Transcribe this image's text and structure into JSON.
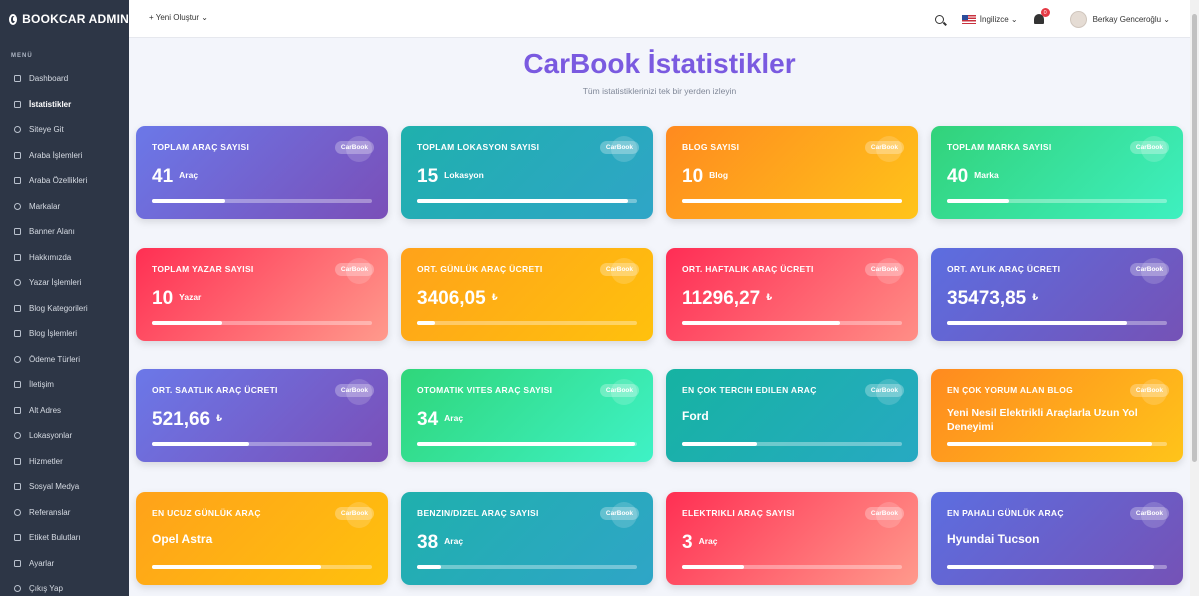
{
  "brand": {
    "title": "BOOKCAR ADMIN"
  },
  "sidebar": {
    "section_title": "MENÜ",
    "items": [
      {
        "label": "Dashboard",
        "icon": "dashboard-icon"
      },
      {
        "label": "İstatistikler",
        "icon": "chart-icon",
        "active": true
      },
      {
        "label": "Siteye Git",
        "icon": "globe-icon"
      },
      {
        "label": "Araba İşlemleri",
        "icon": "car-icon"
      },
      {
        "label": "Araba Özellikleri",
        "icon": "list-icon"
      },
      {
        "label": "Markalar",
        "icon": "briefcase-icon"
      },
      {
        "label": "Banner Alanı",
        "icon": "image-icon"
      },
      {
        "label": "Hakkımızda",
        "icon": "info-icon"
      },
      {
        "label": "Yazar İşlemleri",
        "icon": "pen-icon"
      },
      {
        "label": "Blog Kategorileri",
        "icon": "tag-icon"
      },
      {
        "label": "Blog İşlemleri",
        "icon": "document-icon"
      },
      {
        "label": "Ödeme Türleri",
        "icon": "money-icon"
      },
      {
        "label": "İletişim",
        "icon": "mail-icon"
      },
      {
        "label": "Alt Adres",
        "icon": "address-icon"
      },
      {
        "label": "Lokasyonlar",
        "icon": "location-icon"
      },
      {
        "label": "Hizmetler",
        "icon": "shield-icon"
      },
      {
        "label": "Sosyal Medya",
        "icon": "share-icon"
      },
      {
        "label": "Referanslar",
        "icon": "users-icon"
      },
      {
        "label": "Etiket Bulutları",
        "icon": "cloud-icon"
      },
      {
        "label": "Ayarlar",
        "icon": "gear-icon"
      },
      {
        "label": "Çıkış Yap",
        "icon": "logout-icon"
      }
    ]
  },
  "topbar": {
    "new_label": "+ Yeni Oluştur ⌄",
    "language": "İngilizce ⌄",
    "notification_count": "0",
    "user_name": "Berkay Genceroğlu ⌄"
  },
  "hero": {
    "title": "CarBook İstatistikler",
    "subtitle": "Tüm istatistiklerinizi tek bir yerden izleyin"
  },
  "cards": [
    {
      "title": "TOPLAM ARAÇ SAYISI",
      "badge": "CarBook",
      "value": "41",
      "unit": "Araç",
      "progress": 0.33,
      "theme": "g-purple"
    },
    {
      "title": "TOPLAM LOKASYON SAYISI",
      "badge": "CarBook",
      "value": "15",
      "unit": "Lokasyon",
      "progress": 0.96,
      "theme": "g-teal"
    },
    {
      "title": "BLOG SAYISI",
      "badge": "CarBook",
      "value": "10",
      "unit": "Blog",
      "progress": 1.0,
      "theme": "g-orange"
    },
    {
      "title": "TOPLAM MARKA SAYISI",
      "badge": "CarBook",
      "value": "40",
      "unit": "Marka",
      "progress": 0.28,
      "theme": "g-green"
    },
    {
      "title": "TOPLAM YAZAR SAYISI",
      "badge": "CarBook",
      "value": "10",
      "unit": "Yazar",
      "progress": 0.32,
      "theme": "g-red"
    },
    {
      "title": "ORT. GÜNLÜK ARAÇ ÜCRETI",
      "badge": "CarBook",
      "value": "3406,05",
      "unit": "₺",
      "progress": 0.08,
      "theme": "g-orange2"
    },
    {
      "title": "ORT. HAFTALIK ARAÇ ÜCRETI",
      "badge": "CarBook",
      "value": "11296,27",
      "unit": "₺",
      "progress": 0.72,
      "theme": "g-red2"
    },
    {
      "title": "ORT. AYLIK ARAÇ ÜCRETI",
      "badge": "CarBook",
      "value": "35473,85",
      "unit": "₺",
      "progress": 0.82,
      "theme": "g-violet"
    },
    {
      "title": "ORT. SAATLIK ARAÇ ÜCRETI",
      "badge": "CarBook",
      "value": "521,66",
      "unit": "₺",
      "progress": 0.44,
      "theme": "g-purple"
    },
    {
      "title": "OTOMATIK VITES ARAÇ SAYISI",
      "badge": "CarBook",
      "value": "34",
      "unit": "Araç",
      "progress": 0.99,
      "theme": "g-green2"
    },
    {
      "title": "EN ÇOK TERCIH EDILEN ARAÇ",
      "badge": "CarBook",
      "text": "Ford",
      "progress": 0.34,
      "theme": "g-teal2"
    },
    {
      "title": "EN ÇOK YORUM ALAN BLOG",
      "badge": "CarBook",
      "text": "Yeni Nesil Elektrikli Araçlarla Uzun Yol Deneyimi",
      "progress": 0.93,
      "theme": "g-orange",
      "long": true
    },
    {
      "title": "EN UCUZ GÜNLÜK ARAÇ",
      "badge": "CarBook",
      "text": "Opel Astra",
      "progress": 0.77,
      "theme": "g-orange2"
    },
    {
      "title": "BENZIN/DIZEL ARAÇ SAYISI",
      "badge": "CarBook",
      "value": "38",
      "unit": "Araç",
      "progress": 0.11,
      "theme": "g-teal"
    },
    {
      "title": "ELEKTRIKLI ARAÇ SAYISI",
      "badge": "CarBook",
      "value": "3",
      "unit": "Araç",
      "progress": 0.28,
      "theme": "g-red"
    },
    {
      "title": "EN PAHALI GÜNLÜK ARAÇ",
      "badge": "CarBook",
      "text": "Hyundai Tucson",
      "progress": 0.94,
      "theme": "g-violet"
    }
  ]
}
